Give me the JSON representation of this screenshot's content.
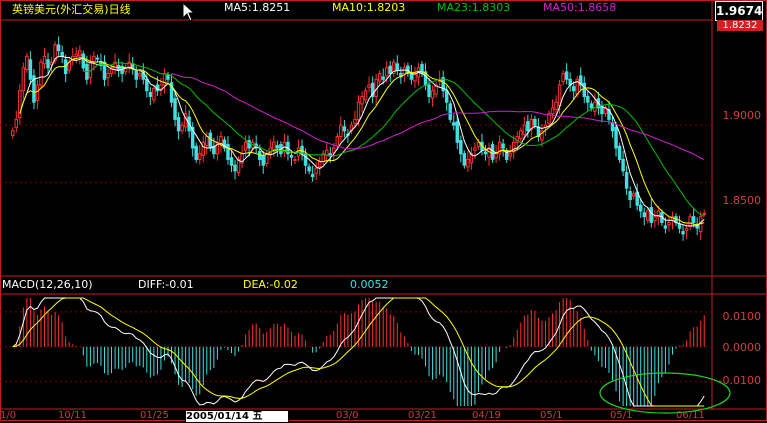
{
  "header": {
    "title": "英镑美元(外汇交易)日线",
    "ma5": "MA5:1.8251",
    "ma10": "MA10:1.8203",
    "ma23": "MA23:1.8303",
    "ma50": "MA50:1.8658",
    "last_price": "1.9674",
    "price_tag": "1.8232"
  },
  "macd_header": {
    "title": "MACD(12,26,10)",
    "diff": "DIFF:-0.01",
    "dea": "DEA:-0.02",
    "macd_value": "0.0052"
  },
  "axis": {
    "price_ticks": [
      "1.9000",
      "1.8500"
    ],
    "macd_ticks": [
      "0.0100",
      "0.0000",
      "-0.0100"
    ]
  },
  "date_bar": {
    "selected": "2005/01/14 五",
    "labels": [
      "1/0",
      "10/11",
      "01/25",
      "",
      "03/0",
      "03/21",
      "04/19",
      "05/1",
      "05/1",
      "06/11"
    ]
  },
  "colors": {
    "background": "#000000",
    "up": "#ff3030",
    "down": "#40e0e0",
    "ma5": "#ffffff",
    "ma10": "#ffff00",
    "ma23": "#00c000",
    "ma50": "#d020d0",
    "grid": "#800000",
    "circle": "#20d020"
  },
  "chart_data": [
    {
      "type": "candlestick",
      "title": "英镑美元(外汇交易)日线",
      "y_ticks": [
        1.85,
        1.9
      ],
      "ylim": [
        1.77,
        1.99
      ],
      "closes": [
        1.895,
        1.905,
        1.93,
        1.95,
        1.96,
        1.94,
        1.92,
        1.935,
        1.955,
        1.96,
        1.95,
        1.955,
        1.97,
        1.965,
        1.96,
        1.945,
        1.955,
        1.96,
        1.962,
        1.965,
        1.95,
        1.94,
        1.955,
        1.96,
        1.958,
        1.952,
        1.94,
        1.945,
        1.95,
        1.955,
        1.948,
        1.945,
        1.95,
        1.955,
        1.95,
        1.94,
        1.945,
        1.94,
        1.93,
        1.925,
        1.932,
        1.93,
        1.935,
        1.945,
        1.94,
        1.92,
        1.905,
        1.895,
        1.9,
        1.91,
        1.895,
        1.88,
        1.87,
        1.875,
        1.885,
        1.89,
        1.88,
        1.875,
        1.885,
        1.89,
        1.88,
        1.87,
        1.865,
        1.86,
        1.87,
        1.875,
        1.885,
        1.88,
        1.885,
        1.88,
        1.87,
        1.865,
        1.875,
        1.88,
        1.885,
        1.88,
        1.875,
        1.885,
        1.875,
        1.872,
        1.87,
        1.88,
        1.875,
        1.865,
        1.86,
        1.855,
        1.862,
        1.868,
        1.875,
        1.878,
        1.873,
        1.88,
        1.89,
        1.9,
        1.895,
        1.892,
        1.9,
        1.905,
        1.92,
        1.925,
        1.93,
        1.935,
        1.925,
        1.94,
        1.945,
        1.94,
        1.95,
        1.945,
        1.955,
        1.948,
        1.942,
        1.95,
        1.945,
        1.94,
        1.945,
        1.95,
        1.945,
        1.935,
        1.925,
        1.93,
        1.935,
        1.94,
        1.93,
        1.92,
        1.905,
        1.9,
        1.885,
        1.875,
        1.865,
        1.87,
        1.875,
        1.88,
        1.885,
        1.878,
        1.875,
        1.88,
        1.87,
        1.875,
        1.885,
        1.88,
        1.87,
        1.875,
        1.885,
        1.89,
        1.895,
        1.9,
        1.895,
        1.905,
        1.9,
        1.89,
        1.895,
        1.9,
        1.91,
        1.915,
        1.92,
        1.935,
        1.945,
        1.94,
        1.935,
        1.93,
        1.94,
        1.935,
        1.925,
        1.92,
        1.915,
        1.92,
        1.915,
        1.91,
        1.915,
        1.905,
        1.895,
        1.88,
        1.87,
        1.86,
        1.845,
        1.835,
        1.84,
        1.83,
        1.825,
        1.82,
        1.825,
        1.815,
        1.82,
        1.825,
        1.815,
        1.81,
        1.815,
        1.82,
        1.815,
        1.81,
        1.805,
        1.81,
        1.82,
        1.815,
        1.81,
        1.82,
        1.823
      ]
    },
    {
      "type": "line",
      "title": "MACD(12,26,10)",
      "series": [
        {
          "name": "DIFF"
        },
        {
          "name": "DEA"
        },
        {
          "name": "MACD"
        }
      ],
      "y_ticks": [
        -0.01,
        0,
        0.01
      ],
      "ylim": [
        -0.017,
        0.014
      ]
    }
  ]
}
